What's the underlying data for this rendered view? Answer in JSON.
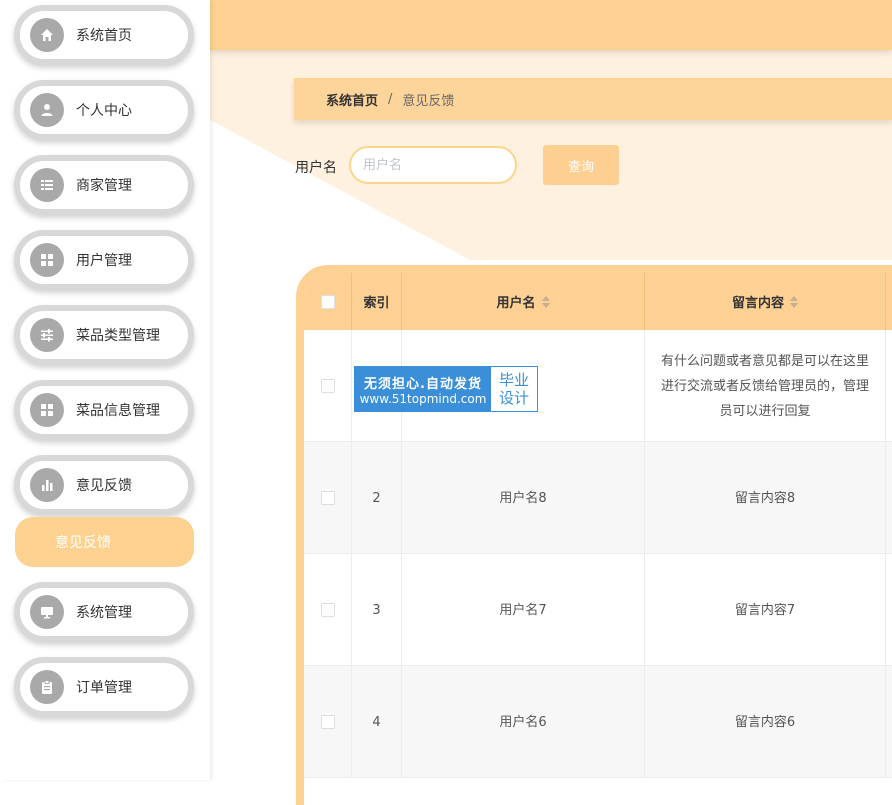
{
  "sidebar": {
    "items": [
      {
        "label": "系统首页",
        "icon": "home-icon"
      },
      {
        "label": "个人中心",
        "icon": "user-icon"
      },
      {
        "label": "商家管理",
        "icon": "list-icon"
      },
      {
        "label": "用户管理",
        "icon": "grid-icon"
      },
      {
        "label": "菜品类型管理",
        "icon": "sliders-icon"
      },
      {
        "label": "菜品信息管理",
        "icon": "grid-icon"
      },
      {
        "label": "意见反馈",
        "icon": "bar-chart-icon"
      },
      {
        "label": "系统管理",
        "icon": "monitor-icon"
      },
      {
        "label": "订单管理",
        "icon": "clipboard-icon"
      }
    ],
    "active_submenu": {
      "label": "意见反馈"
    }
  },
  "breadcrumb": {
    "home": "系统首页",
    "separator": "/",
    "current": "意见反馈"
  },
  "search": {
    "label": "用户名",
    "placeholder": "用户名",
    "value": "",
    "button_label": "查询"
  },
  "table": {
    "columns": [
      "索引",
      "用户名",
      "留言内容"
    ],
    "rows": [
      {
        "index": "",
        "username": "",
        "content": "有什么问题或者意见都是可以在这里进行交流或者反馈给管理员的，管理员可以进行回复"
      },
      {
        "index": "2",
        "username": "用户名8",
        "content": "留言内容8"
      },
      {
        "index": "3",
        "username": "用户名7",
        "content": "留言内容7"
      },
      {
        "index": "4",
        "username": "用户名6",
        "content": "留言内容6"
      }
    ]
  },
  "watermark": {
    "line1": "无须担心.自动发货",
    "line2": "www.51topmind.com",
    "right1": "毕业",
    "right2": "设计"
  },
  "colors": {
    "accent": "#fdd092",
    "icon_circle": "#a9a9a9",
    "watermark_blue": "#3a8fd8"
  }
}
